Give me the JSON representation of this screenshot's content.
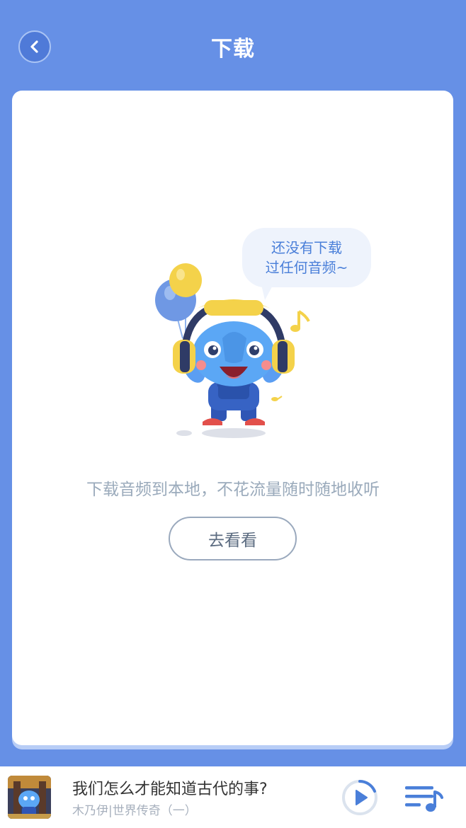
{
  "header": {
    "title": "下载",
    "back_icon": "chevron-left-icon"
  },
  "empty_state": {
    "bubble_line1": "还没有下载",
    "bubble_line2": "过任何音频~",
    "message": "下载音频到本地，不花流量随时随地收听",
    "button_label": "去看看"
  },
  "now_playing": {
    "title": "我们怎么才能知道古代的事?",
    "subtitle": "木乃伊|世界传奇（一）",
    "play_icon": "play-icon",
    "playlist_icon": "playlist-icon"
  },
  "colors": {
    "background": "#6690e6",
    "accent": "#4a7fd9",
    "card": "#ffffff"
  }
}
